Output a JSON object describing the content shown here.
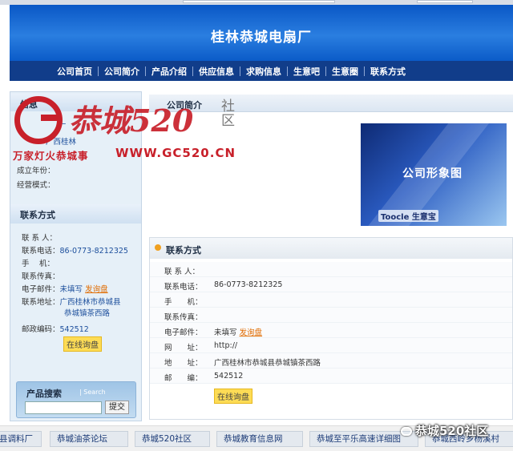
{
  "banner": {
    "company_name": "桂林恭城电扇厂"
  },
  "nav": [
    "公司首页",
    "公司简介",
    "产品介绍",
    "供应信息",
    "求购信息",
    "生意吧",
    "生意圈",
    "联系方式"
  ],
  "sidebar": {
    "info_partial": [
      "信息",
      "厂",
      "西",
      "广西桂林"
    ],
    "founded_label": "成立年份：",
    "model_label": "经营模式：",
    "contact_title": "联系方式",
    "contact_rows": [
      {
        "key": "联 系 人：",
        "value": ""
      },
      {
        "key": "联系电话：",
        "value": "86-0773-8212325"
      },
      {
        "key": "手　 机：",
        "value": ""
      },
      {
        "key": "联系传真：",
        "value": ""
      },
      {
        "key": "电子邮件：",
        "value": "未填写",
        "link": "发询盘"
      },
      {
        "key": "联系地址：",
        "value": "广西桂林市恭城县",
        "value2": "恭城镇茶西路"
      },
      {
        "key": "邮政编码：",
        "value": "542512"
      }
    ],
    "inquiry_button": "在线询盘",
    "search_title": "产品搜索",
    "search_sub": "| Search",
    "search_button": "提交"
  },
  "main": {
    "intro_title": "公司简介",
    "promo_text": "公司形象图",
    "promo_logo": "Toocle 生意宝",
    "contact_title": "联系方式",
    "contact_rows": [
      {
        "key": "联 系 人：",
        "value": ""
      },
      {
        "key": "联系电话：",
        "value": "86-0773-8212325"
      },
      {
        "key": "手　　机：",
        "value": ""
      },
      {
        "key": "联系传真：",
        "value": ""
      },
      {
        "key": "电子邮件：",
        "value": "未填写",
        "link": "发询盘"
      },
      {
        "key": "网　　址：",
        "value": "http://"
      },
      {
        "key": "地　　址：",
        "value": "广西桂林市恭城县恭城镇茶西路"
      },
      {
        "key": "邮　　编：",
        "value": "542512"
      }
    ],
    "inquiry_button": "在线询盘"
  },
  "watermark": {
    "brand": "恭城520",
    "she": "社",
    "qu": "区",
    "slogan": "万家灯火恭城事",
    "url": "WWW.GC520.CN"
  },
  "bottom_tabs": [
    "县调料厂",
    "恭城油茶论坛",
    "恭城520社区",
    "恭城教育信息网",
    "恭城至平乐高速详细图",
    "恭城西岭乡杨溪村"
  ],
  "wechat_label": "恭城520社区"
}
